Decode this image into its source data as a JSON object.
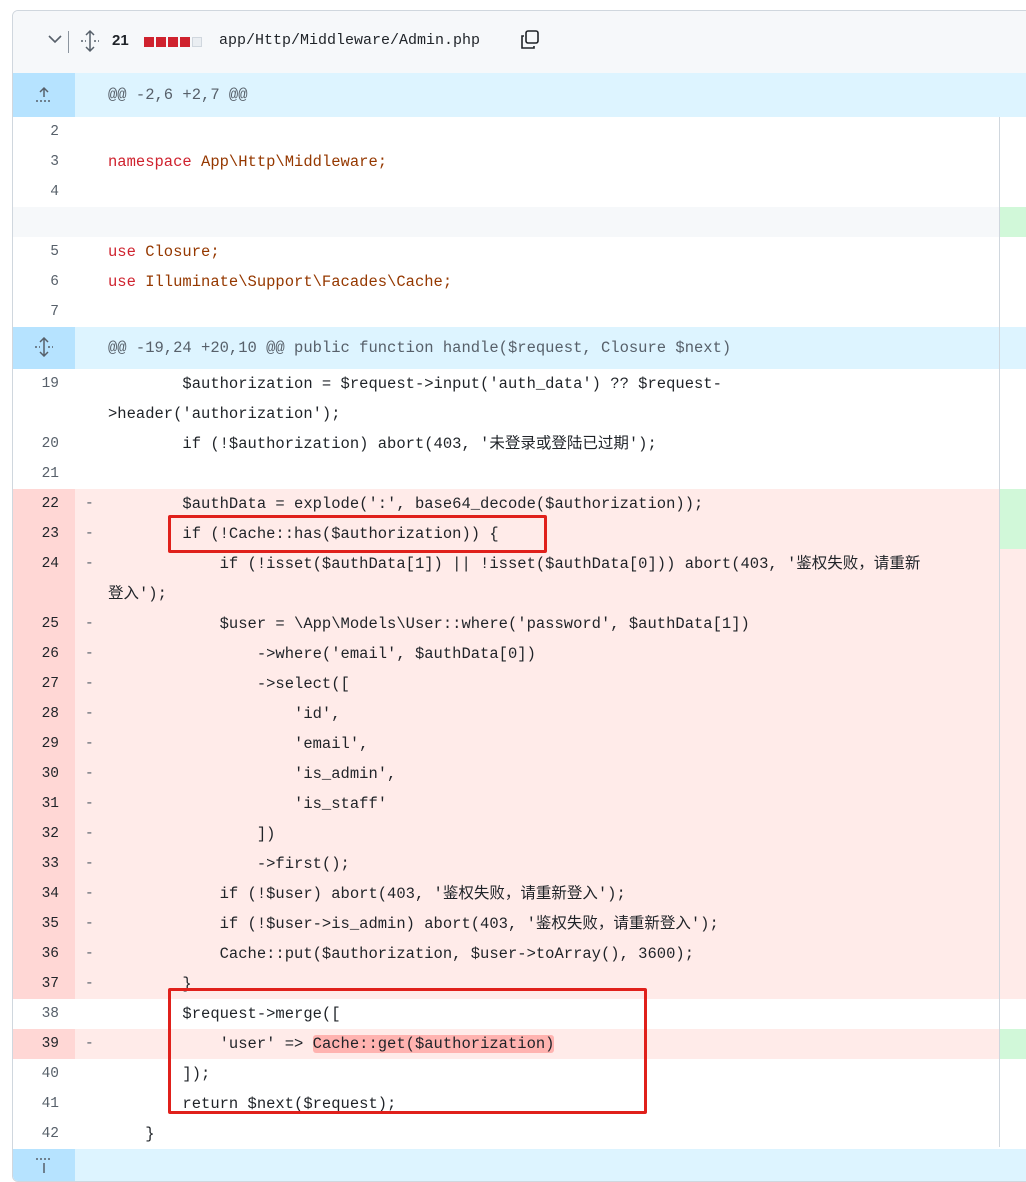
{
  "file_header": {
    "changes_count": "21",
    "file_path": "app/Http/Middleware/Admin.php",
    "diffstat": {
      "deleted_blocks": 4,
      "neutral_blocks": 1
    }
  },
  "hunks": {
    "first": "@@ -2,6 +2,7 @@",
    "second": "@@ -19,24 +20,10 @@ public function handle($request, Closure $next)"
  },
  "lines": {
    "l2": "",
    "l3_ns_kw": "namespace",
    "l3_ns_rest": " App\\Http\\Middleware;",
    "l5_kw": "use",
    "l5_rest": " Closure;",
    "l6_kw": "use",
    "l6_rest": " Illuminate\\Support\\Facades\\Cache;",
    "l19a": "        $authorization = $request->input('auth_data') ?? $request-",
    "l19b": ">header('authorization');",
    "l20": "        if (!$authorization) abort(403, '未登录或登陆已过期');",
    "l22": "        $authData = explode(':', base64_decode($authorization));",
    "l23": "        if (!Cache::has($authorization)) {",
    "l24a": "            if (!isset($authData[1]) || !isset($authData[0])) abort(403, '鉴权失败，请重新",
    "l24b": "登入');",
    "l25": "            $user = \\App\\Models\\User::where('password', $authData[1])",
    "l26": "                ->where('email', $authData[0])",
    "l27": "                ->select([",
    "l28": "                    'id',",
    "l29": "                    'email',",
    "l30": "                    'is_admin',",
    "l31": "                    'is_staff'",
    "l32": "                ])",
    "l33": "                ->first();",
    "l34": "            if (!$user) abort(403, '鉴权失败，请重新登入');",
    "l35": "            if (!$user->is_admin) abort(403, '鉴权失败，请重新登入');",
    "l36": "            Cache::put($authorization, $user->toArray(), 3600);",
    "l37": "        }",
    "l38": "        $request->merge([",
    "l39_pre": "            'user' => ",
    "l39_hl": "Cache::get($authorization)",
    "l40": "        ]);",
    "l41": "        return $next($request);",
    "l42": "    }"
  },
  "line_numbers": [
    "2",
    "3",
    "4",
    "5",
    "6",
    "7",
    "19",
    "20",
    "21",
    "22",
    "23",
    "24",
    "25",
    "26",
    "27",
    "28",
    "29",
    "30",
    "31",
    "32",
    "33",
    "34",
    "35",
    "36",
    "37",
    "38",
    "39",
    "40",
    "41",
    "42"
  ],
  "signs": {
    "del": "-"
  },
  "colors": {
    "deletion_bg": "#ffebe9",
    "deletion_gutter": "#ffd7d5",
    "hunk_bg": "#ddf4ff",
    "addition_bg": "#d1f8d9",
    "annotation_box": "#e0201b"
  }
}
